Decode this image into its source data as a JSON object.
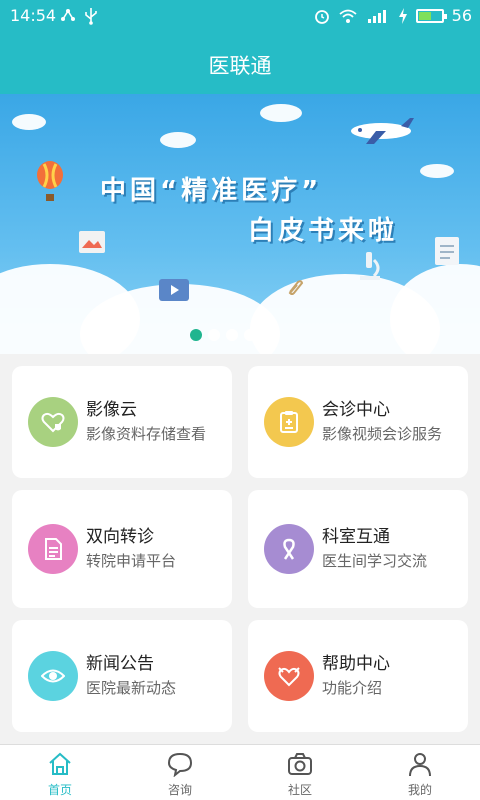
{
  "status": {
    "time": "14:54",
    "battery": "56",
    "battery_level": 0.56
  },
  "header": {
    "title": "医联通"
  },
  "banner": {
    "line1": "中国“精准医疗”",
    "line2": "白皮书来啦",
    "slide_count": 5,
    "active_slide": 1
  },
  "cards": [
    {
      "title": "影像云",
      "subtitle": "影像资料存储查看",
      "color": "#a8d180",
      "icon": "heart-shield-icon"
    },
    {
      "title": "会诊中心",
      "subtitle": "影像视频会诊服务",
      "color": "#f3c84f",
      "icon": "clipboard-medical-icon"
    },
    {
      "title": "双向转诊",
      "subtitle": "转院申请平台",
      "color": "#e781c2",
      "icon": "document-icon"
    },
    {
      "title": "科室互通",
      "subtitle": "医生间学习交流",
      "color": "#a68cd2",
      "icon": "ribbon-icon"
    },
    {
      "title": "新闻公告",
      "subtitle": "医院最新动态",
      "color": "#5bd3e0",
      "icon": "eye-icon"
    },
    {
      "title": "帮助中心",
      "subtitle": "功能介绍",
      "color": "#ef6a52",
      "icon": "handshake-heart-icon"
    }
  ],
  "nav": [
    {
      "label": "首页",
      "icon": "home-icon",
      "active": true
    },
    {
      "label": "咨询",
      "icon": "chat-bubble-icon",
      "active": false
    },
    {
      "label": "社区",
      "icon": "camera-icon",
      "active": false
    },
    {
      "label": "我的",
      "icon": "person-icon",
      "active": false
    }
  ],
  "colors": {
    "accent": "#26bcc6",
    "active_dot": "#20b58f"
  }
}
